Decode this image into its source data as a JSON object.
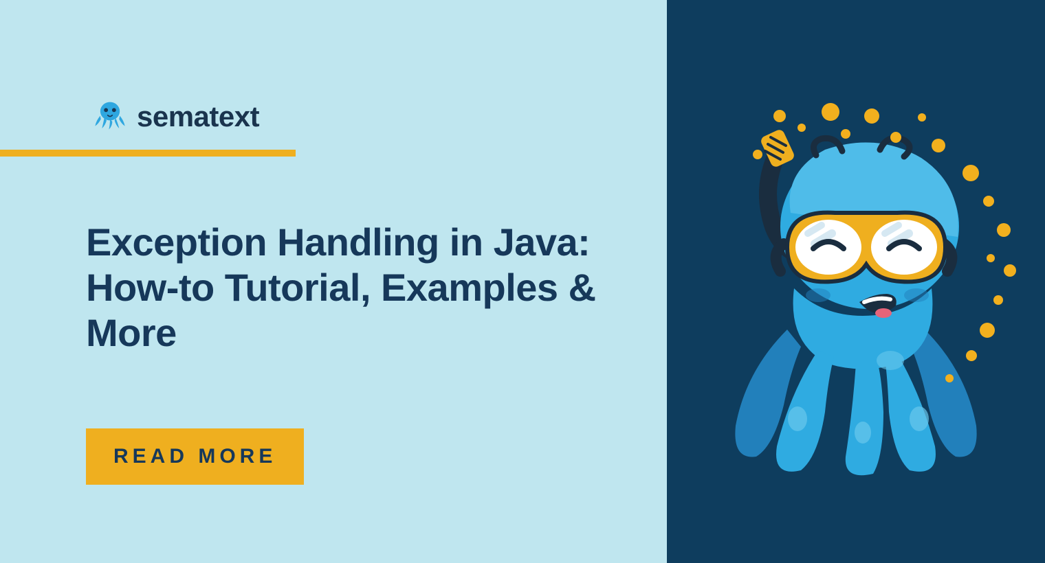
{
  "brand": {
    "name": "sematext",
    "logo_icon": "octopus"
  },
  "title": "Exception Handling in Java: How-to Tutorial, Examples & More",
  "cta": {
    "label": "READ MORE"
  },
  "colors": {
    "left_bg": "#bfe6ef",
    "right_bg": "#0e3d5e",
    "accent": "#EFAF1F",
    "text_dark": "#16385a",
    "mascot_blue": "#2fabe1",
    "mascot_dark_blue": "#2280bb"
  },
  "mascot": {
    "type": "octopus",
    "accessory": "snorkel-goggles"
  }
}
